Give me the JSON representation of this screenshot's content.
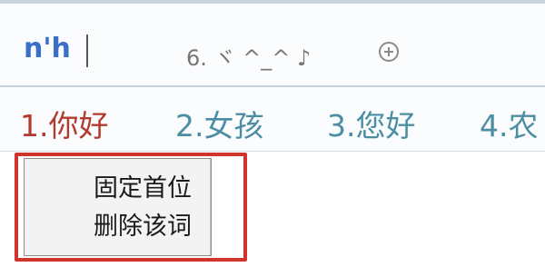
{
  "ime": {
    "composition": "n'h",
    "extra_candidate": "6. ヾ ^_^ ♪",
    "candidates": [
      {
        "index": "1.",
        "text": "你好"
      },
      {
        "index": "2.",
        "text": "女孩"
      },
      {
        "index": "3.",
        "text": "您好"
      },
      {
        "index": "4.",
        "text": "农"
      }
    ]
  },
  "context_menu": {
    "items": [
      {
        "label": "固定首位"
      },
      {
        "label": "删除该词"
      }
    ]
  },
  "colors": {
    "composition": "#3a6fc8",
    "selected_candidate": "#b23a2e",
    "candidate": "#4b8ea3",
    "highlight": "#d0342c"
  },
  "icons": {
    "add": "plus-circle-icon"
  }
}
